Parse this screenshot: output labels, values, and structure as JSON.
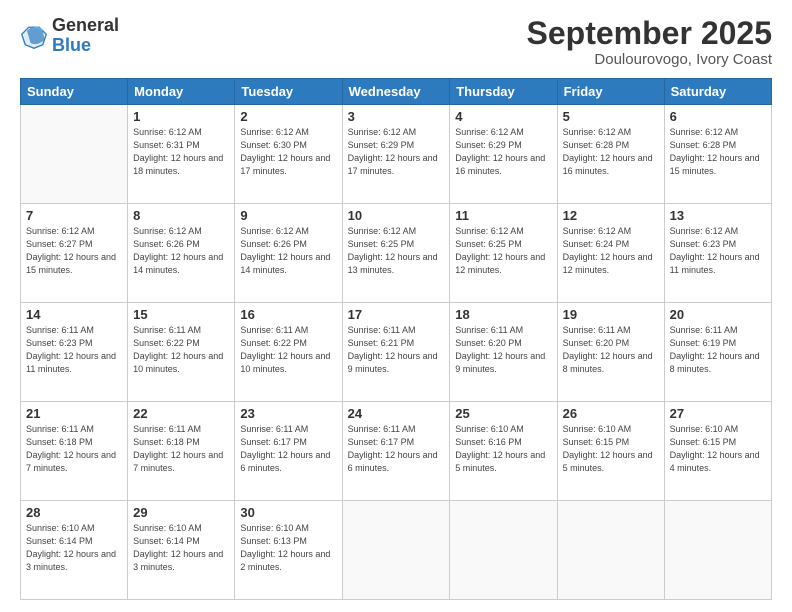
{
  "logo": {
    "general": "General",
    "blue": "Blue"
  },
  "title": "September 2025",
  "subtitle": "Doulourovogo, Ivory Coast",
  "days_header": [
    "Sunday",
    "Monday",
    "Tuesday",
    "Wednesday",
    "Thursday",
    "Friday",
    "Saturday"
  ],
  "weeks": [
    [
      {
        "day": "",
        "info": ""
      },
      {
        "day": "1",
        "info": "Sunrise: 6:12 AM\nSunset: 6:31 PM\nDaylight: 12 hours\nand 18 minutes."
      },
      {
        "day": "2",
        "info": "Sunrise: 6:12 AM\nSunset: 6:30 PM\nDaylight: 12 hours\nand 17 minutes."
      },
      {
        "day": "3",
        "info": "Sunrise: 6:12 AM\nSunset: 6:29 PM\nDaylight: 12 hours\nand 17 minutes."
      },
      {
        "day": "4",
        "info": "Sunrise: 6:12 AM\nSunset: 6:29 PM\nDaylight: 12 hours\nand 16 minutes."
      },
      {
        "day": "5",
        "info": "Sunrise: 6:12 AM\nSunset: 6:28 PM\nDaylight: 12 hours\nand 16 minutes."
      },
      {
        "day": "6",
        "info": "Sunrise: 6:12 AM\nSunset: 6:28 PM\nDaylight: 12 hours\nand 15 minutes."
      }
    ],
    [
      {
        "day": "7",
        "info": "Sunrise: 6:12 AM\nSunset: 6:27 PM\nDaylight: 12 hours\nand 15 minutes."
      },
      {
        "day": "8",
        "info": "Sunrise: 6:12 AM\nSunset: 6:26 PM\nDaylight: 12 hours\nand 14 minutes."
      },
      {
        "day": "9",
        "info": "Sunrise: 6:12 AM\nSunset: 6:26 PM\nDaylight: 12 hours\nand 14 minutes."
      },
      {
        "day": "10",
        "info": "Sunrise: 6:12 AM\nSunset: 6:25 PM\nDaylight: 12 hours\nand 13 minutes."
      },
      {
        "day": "11",
        "info": "Sunrise: 6:12 AM\nSunset: 6:25 PM\nDaylight: 12 hours\nand 12 minutes."
      },
      {
        "day": "12",
        "info": "Sunrise: 6:12 AM\nSunset: 6:24 PM\nDaylight: 12 hours\nand 12 minutes."
      },
      {
        "day": "13",
        "info": "Sunrise: 6:12 AM\nSunset: 6:23 PM\nDaylight: 12 hours\nand 11 minutes."
      }
    ],
    [
      {
        "day": "14",
        "info": "Sunrise: 6:11 AM\nSunset: 6:23 PM\nDaylight: 12 hours\nand 11 minutes."
      },
      {
        "day": "15",
        "info": "Sunrise: 6:11 AM\nSunset: 6:22 PM\nDaylight: 12 hours\nand 10 minutes."
      },
      {
        "day": "16",
        "info": "Sunrise: 6:11 AM\nSunset: 6:22 PM\nDaylight: 12 hours\nand 10 minutes."
      },
      {
        "day": "17",
        "info": "Sunrise: 6:11 AM\nSunset: 6:21 PM\nDaylight: 12 hours\nand 9 minutes."
      },
      {
        "day": "18",
        "info": "Sunrise: 6:11 AM\nSunset: 6:20 PM\nDaylight: 12 hours\nand 9 minutes."
      },
      {
        "day": "19",
        "info": "Sunrise: 6:11 AM\nSunset: 6:20 PM\nDaylight: 12 hours\nand 8 minutes."
      },
      {
        "day": "20",
        "info": "Sunrise: 6:11 AM\nSunset: 6:19 PM\nDaylight: 12 hours\nand 8 minutes."
      }
    ],
    [
      {
        "day": "21",
        "info": "Sunrise: 6:11 AM\nSunset: 6:18 PM\nDaylight: 12 hours\nand 7 minutes."
      },
      {
        "day": "22",
        "info": "Sunrise: 6:11 AM\nSunset: 6:18 PM\nDaylight: 12 hours\nand 7 minutes."
      },
      {
        "day": "23",
        "info": "Sunrise: 6:11 AM\nSunset: 6:17 PM\nDaylight: 12 hours\nand 6 minutes."
      },
      {
        "day": "24",
        "info": "Sunrise: 6:11 AM\nSunset: 6:17 PM\nDaylight: 12 hours\nand 6 minutes."
      },
      {
        "day": "25",
        "info": "Sunrise: 6:10 AM\nSunset: 6:16 PM\nDaylight: 12 hours\nand 5 minutes."
      },
      {
        "day": "26",
        "info": "Sunrise: 6:10 AM\nSunset: 6:15 PM\nDaylight: 12 hours\nand 5 minutes."
      },
      {
        "day": "27",
        "info": "Sunrise: 6:10 AM\nSunset: 6:15 PM\nDaylight: 12 hours\nand 4 minutes."
      }
    ],
    [
      {
        "day": "28",
        "info": "Sunrise: 6:10 AM\nSunset: 6:14 PM\nDaylight: 12 hours\nand 3 minutes."
      },
      {
        "day": "29",
        "info": "Sunrise: 6:10 AM\nSunset: 6:14 PM\nDaylight: 12 hours\nand 3 minutes."
      },
      {
        "day": "30",
        "info": "Sunrise: 6:10 AM\nSunset: 6:13 PM\nDaylight: 12 hours\nand 2 minutes."
      },
      {
        "day": "",
        "info": ""
      },
      {
        "day": "",
        "info": ""
      },
      {
        "day": "",
        "info": ""
      },
      {
        "day": "",
        "info": ""
      }
    ]
  ]
}
